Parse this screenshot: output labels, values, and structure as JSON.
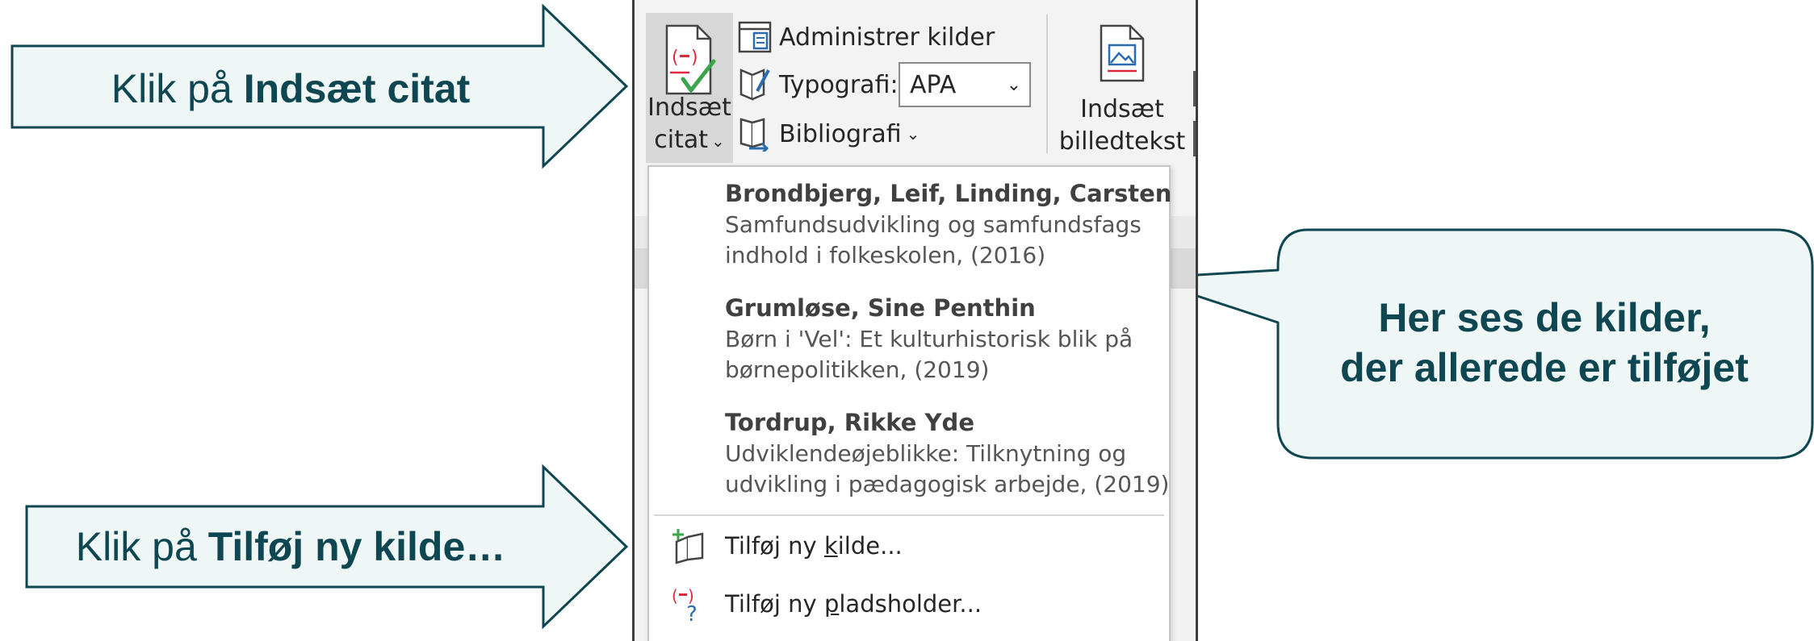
{
  "callouts": {
    "insert_citation": {
      "prefix": "Klik på ",
      "bold": "Indsæt citat"
    },
    "add_source": {
      "prefix": "Klik på ",
      "bold": "Tilføj ny kilde…"
    }
  },
  "bubble": {
    "line1": "Her ses de kilder,",
    "line2": "der allerede er tilføjet"
  },
  "ribbon": {
    "insert_citation": {
      "line1": "Indsæt",
      "line2": "citat"
    },
    "manage_sources": "Administrer kilder",
    "style_label": "Typografi:",
    "style_value": "APA",
    "bibliography": "Bibliografi",
    "insert_caption": {
      "line1": "Indsæt",
      "line2": "billedtekst"
    }
  },
  "dropdown": {
    "sources": [
      {
        "author": "Brondbjerg, Leif,  Linding, Carsten",
        "title_line1": "Samfundsudvikling og samfundsfags",
        "title_line2": "indhold i folkeskolen, (2016)"
      },
      {
        "author": "Grumløse, Sine Penthin",
        "title_line1": "Børn i 'Vel': Et kulturhistorisk blik på",
        "title_line2": "børnepolitikken, (2019)"
      },
      {
        "author": "Tordrup, Rikke Yde",
        "title_line1": "Udviklendeøjeblikke: Tilknytning og",
        "title_line2": "udvikling i pædagogisk arbejde, (2019)"
      }
    ],
    "add_source": {
      "before": "Tilføj ny ",
      "accel": "k",
      "after": "ilde..."
    },
    "add_placeholder": {
      "before": "Tilføj ny ",
      "accel": "p",
      "after": "ladsholder..."
    }
  },
  "colors": {
    "callout_fill": "#eef7f5",
    "callout_stroke": "#0e4651",
    "callout_text": "#0e4651",
    "citation_red": "#e0283c",
    "check_green": "#3aa54a",
    "icon_blue": "#2b6cb0"
  }
}
